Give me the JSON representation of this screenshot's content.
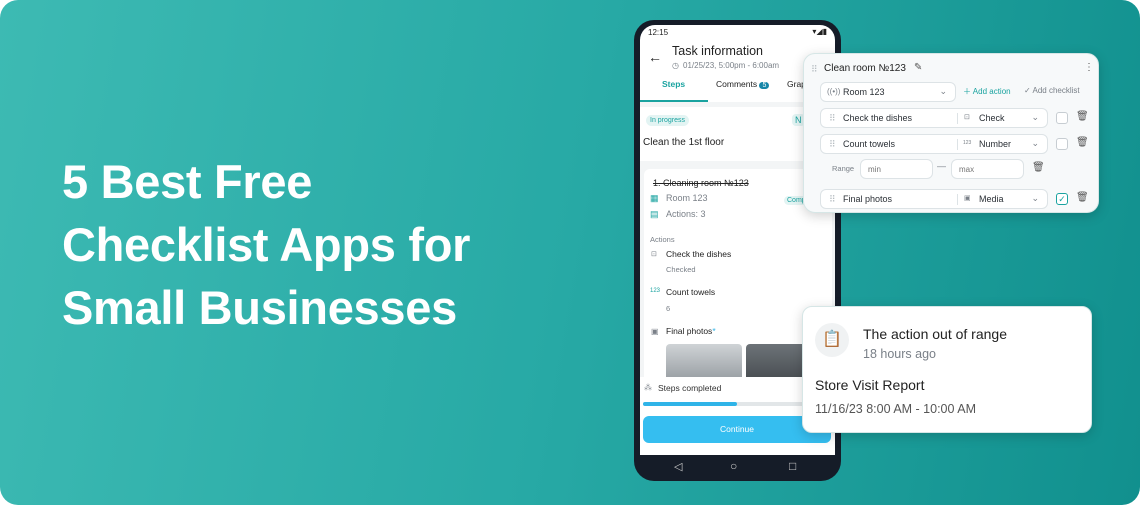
{
  "headline": [
    "5 Best Free",
    "Checklist Apps for",
    "Small Businesses"
  ],
  "colors": {
    "accent": "#1aa3a0",
    "continue": "#35bef0",
    "progress": "#2fb4e8"
  },
  "phone": {
    "status_time": "12:15",
    "title": "Task information",
    "datetime": "01/25/23, 5:00pm - 6:00am",
    "tabs": [
      {
        "label": "Steps",
        "active": true
      },
      {
        "label": "Comments",
        "badge": "5"
      },
      {
        "label": "Graph"
      }
    ],
    "status_chip": "In progress",
    "chip_n": "N",
    "task_title": "Clean the 1st floor",
    "step": {
      "title": "1. Cleaning room №123",
      "room": "Room 123",
      "actions_count": "Actions: 3",
      "badge": "Comp"
    },
    "actions_label": "Actions",
    "actions": [
      {
        "name": "Check the dishes",
        "value": "Checked"
      },
      {
        "name": "Count towels",
        "value": "6"
      },
      {
        "name": "Final photos",
        "required": "*"
      }
    ],
    "steps_completed": "Steps completed",
    "progress": 0.5,
    "continue": "Continue"
  },
  "editor": {
    "title": "Clean room №123",
    "room_select": "Room 123",
    "add_action": "Add action",
    "add_checklist": "Add checklist",
    "rows": [
      {
        "name": "Check the dishes",
        "type": "Check",
        "checked": false
      },
      {
        "name": "Count towels",
        "type": "Number",
        "checked": false
      },
      {
        "name": "Final photos",
        "type": "Media",
        "checked": true
      }
    ],
    "range_label": "Range",
    "min_placeholder": "min",
    "max_placeholder": "max"
  },
  "notification": {
    "title": "The action out of range",
    "time": "18 hours ago",
    "report": "Store Visit Report",
    "range": "11/16/23 8:00 AM - 10:00 AM"
  }
}
